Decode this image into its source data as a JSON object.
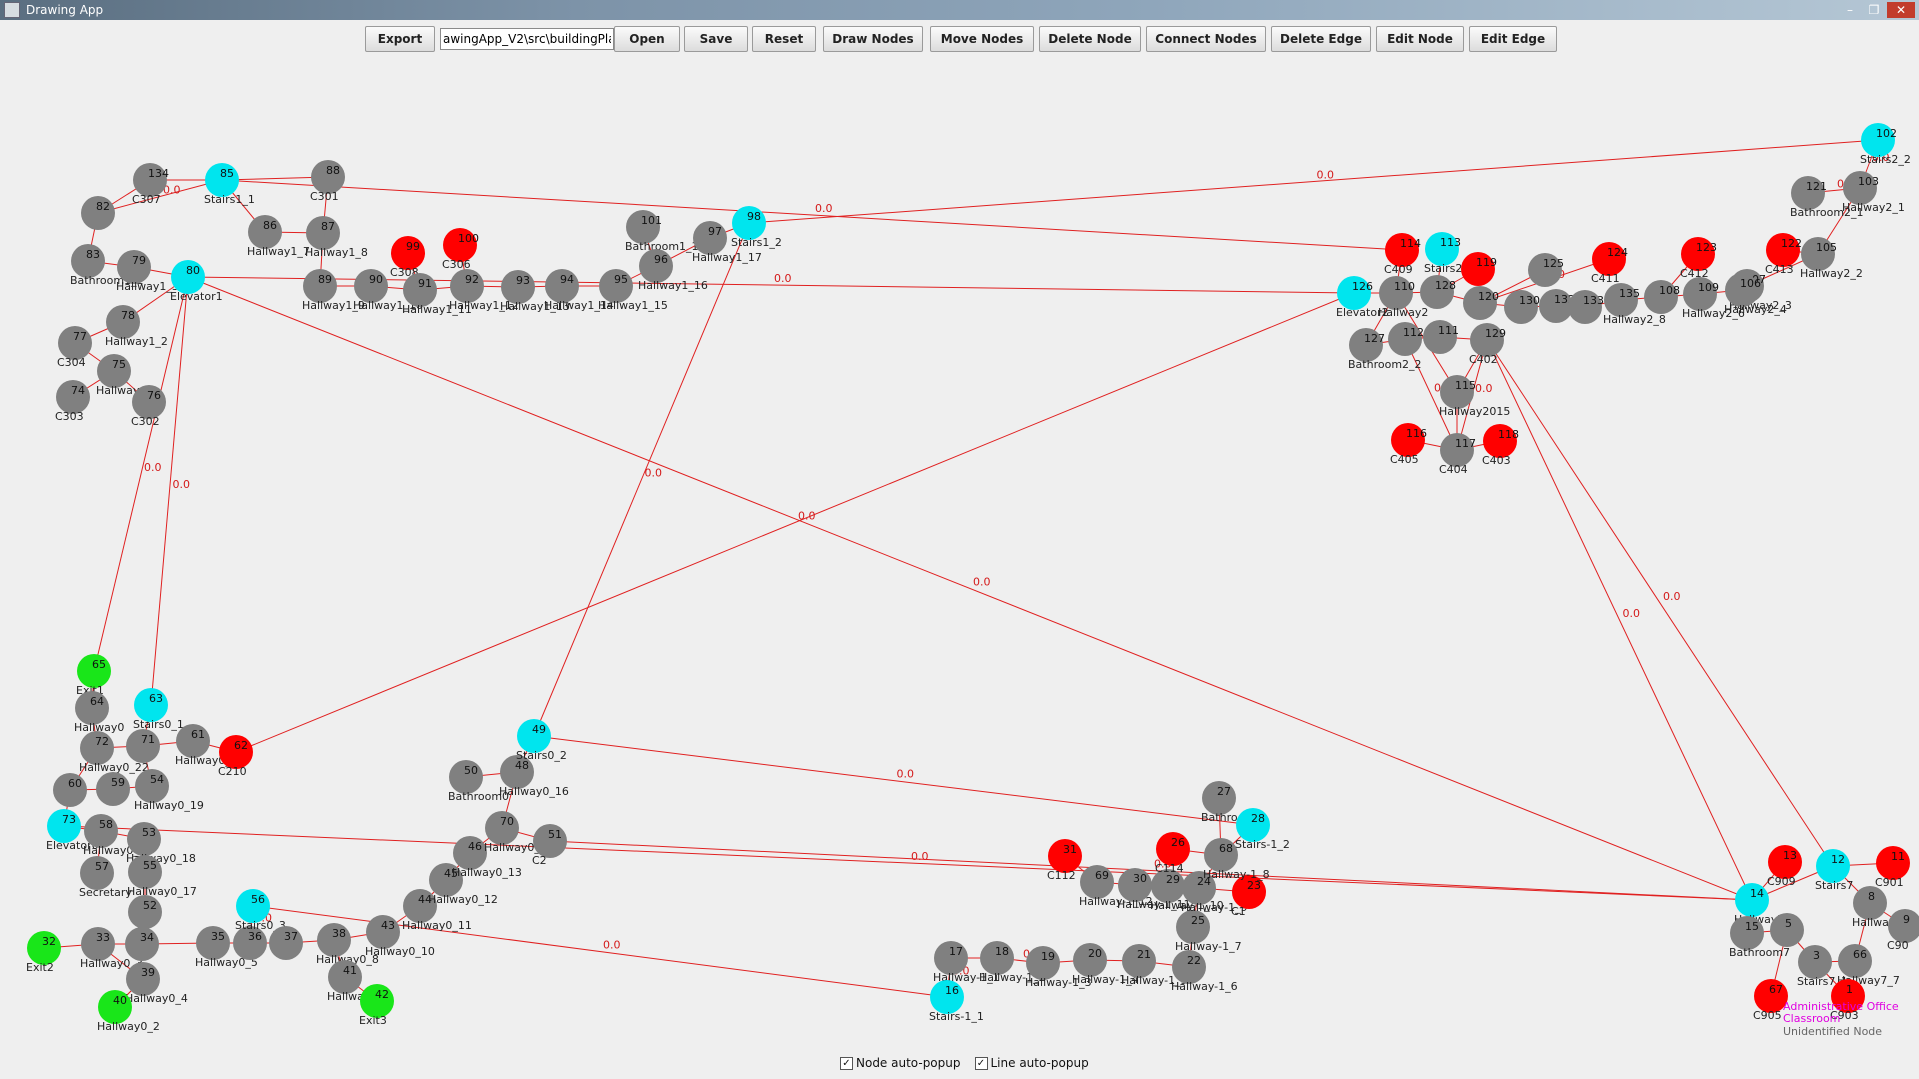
{
  "window": {
    "title": "Drawing App"
  },
  "toolbar": {
    "export_label": "Export",
    "path_value": "awingApp_V2\\src\\buildingPlan",
    "open_label": "Open",
    "save_label": "Save",
    "reset_label": "Reset",
    "draw_nodes_label": "Draw Nodes",
    "move_nodes_label": "Move Nodes",
    "delete_node_label": "Delete Node",
    "connect_nodes_label": "Connect Nodes",
    "delete_edge_label": "Delete Edge",
    "edit_node_label": "Edit Node",
    "edit_edge_label": "Edit Edge"
  },
  "options": {
    "node_popup_label": "Node auto-popup",
    "node_popup_checked": true,
    "line_popup_label": "Line auto-popup",
    "line_popup_checked": true
  },
  "colors": {
    "hallway": "#808080",
    "stairs": "#00e5ee",
    "room": "#ff0000",
    "exit": "#19e619",
    "edge": "#e02020"
  },
  "graph": {
    "nodes": [
      {
        "id": "134",
        "label": "C307",
        "type": "hallway"
      },
      {
        "id": "85",
        "label": "Stairs1_1",
        "type": "stairs"
      },
      {
        "id": "88",
        "label": "C301",
        "type": "hallway"
      },
      {
        "id": "82",
        "label": "",
        "type": "hallway"
      },
      {
        "id": "86",
        "label": "Hallway1_7",
        "type": "hallway"
      },
      {
        "id": "87",
        "label": "Hallway1_8",
        "type": "hallway"
      },
      {
        "id": "83",
        "label": "Bathroom1_2",
        "type": "hallway"
      },
      {
        "id": "79",
        "label": "Hallway1_3",
        "type": "hallway"
      },
      {
        "id": "80",
        "label": "Elevator1",
        "type": "stairs"
      },
      {
        "id": "78",
        "label": "Hallway1_2",
        "type": "hallway"
      },
      {
        "id": "77",
        "label": "C304",
        "type": "hallway"
      },
      {
        "id": "75",
        "label": "Hallway",
        "type": "hallway"
      },
      {
        "id": "74",
        "label": "C303",
        "type": "hallway"
      },
      {
        "id": "76",
        "label": "C302",
        "type": "hallway"
      },
      {
        "id": "99",
        "label": "C308",
        "type": "room"
      },
      {
        "id": "100",
        "label": "C306",
        "type": "room"
      },
      {
        "id": "89",
        "label": "Hallway1_9",
        "type": "hallway"
      },
      {
        "id": "90",
        "label": "Hallway1_10",
        "type": "hallway"
      },
      {
        "id": "91",
        "label": "Hallway1_11",
        "type": "hallway"
      },
      {
        "id": "92",
        "label": "Hallway1_12",
        "type": "hallway"
      },
      {
        "id": "93",
        "label": "Hallway1_13",
        "type": "hallway"
      },
      {
        "id": "94",
        "label": "Hallway1_14",
        "type": "hallway"
      },
      {
        "id": "95",
        "label": "Hallway1_15",
        "type": "hallway"
      },
      {
        "id": "101",
        "label": "Bathroom1_1",
        "type": "hallway"
      },
      {
        "id": "97",
        "label": "Hallway1_17",
        "type": "hallway"
      },
      {
        "id": "98",
        "label": "Stairs1_2",
        "type": "stairs"
      },
      {
        "id": "96",
        "label": "Hallway1_16",
        "type": "hallway"
      },
      {
        "id": "102",
        "label": "Stairs2_2",
        "type": "stairs"
      },
      {
        "id": "121",
        "label": "Bathroom2_1",
        "type": "hallway"
      },
      {
        "id": "103",
        "label": "Hallway2_1",
        "type": "hallway"
      },
      {
        "id": "122",
        "label": "C413",
        "type": "room"
      },
      {
        "id": "105",
        "label": "Hallway2_2",
        "type": "hallway"
      },
      {
        "id": "107",
        "label": "Hallway2_3",
        "type": "hallway"
      },
      {
        "id": "123",
        "label": "C412",
        "type": "room"
      },
      {
        "id": "124",
        "label": "C411",
        "type": "room"
      },
      {
        "id": "125",
        "label": "",
        "type": "hallway"
      },
      {
        "id": "114",
        "label": "C409",
        "type": "room"
      },
      {
        "id": "113",
        "label": "Stairs2_1",
        "type": "stairs"
      },
      {
        "id": "119",
        "label": "",
        "type": "room"
      },
      {
        "id": "126",
        "label": "Elevator2",
        "type": "stairs"
      },
      {
        "id": "110",
        "label": "Hallway2",
        "type": "hallway"
      },
      {
        "id": "128",
        "label": "",
        "type": "hallway"
      },
      {
        "id": "120",
        "label": "",
        "type": "hallway"
      },
      {
        "id": "130",
        "label": "",
        "type": "hallway"
      },
      {
        "id": "132",
        "label": "",
        "type": "hallway"
      },
      {
        "id": "133",
        "label": "",
        "type": "hallway"
      },
      {
        "id": "135",
        "label": "Hallway2_8",
        "type": "hallway"
      },
      {
        "id": "108",
        "label": "",
        "type": "hallway"
      },
      {
        "id": "109",
        "label": "Hallway2_6",
        "type": "hallway"
      },
      {
        "id": "106",
        "label": "Hallway2_4",
        "type": "hallway"
      },
      {
        "id": "127",
        "label": "Bathroom2_2",
        "type": "hallway"
      },
      {
        "id": "112",
        "label": "",
        "type": "hallway"
      },
      {
        "id": "111",
        "label": "",
        "type": "hallway"
      },
      {
        "id": "129",
        "label": "C402",
        "type": "hallway"
      },
      {
        "id": "115",
        "label": "Hallway2015",
        "type": "hallway"
      },
      {
        "id": "116",
        "label": "C405",
        "type": "room"
      },
      {
        "id": "117",
        "label": "C404",
        "type": "hallway"
      },
      {
        "id": "118",
        "label": "C403",
        "type": "room"
      },
      {
        "id": "65",
        "label": "Exit1",
        "type": "exit"
      },
      {
        "id": "64",
        "label": "Hallway0",
        "type": "hallway"
      },
      {
        "id": "63",
        "label": "Stairs0_1",
        "type": "stairs"
      },
      {
        "id": "72",
        "label": "Hallway0_22",
        "type": "hallway"
      },
      {
        "id": "71",
        "label": "",
        "type": "hallway"
      },
      {
        "id": "61",
        "label": "Hallway0_20",
        "type": "hallway"
      },
      {
        "id": "62",
        "label": "C210",
        "type": "room"
      },
      {
        "id": "60",
        "label": "",
        "type": "hallway"
      },
      {
        "id": "59",
        "label": "",
        "type": "hallway"
      },
      {
        "id": "54",
        "label": "Hallway0_19",
        "type": "hallway"
      },
      {
        "id": "73",
        "label": "Elevator0",
        "type": "stairs"
      },
      {
        "id": "58",
        "label": "Hallway0_21",
        "type": "hallway"
      },
      {
        "id": "53",
        "label": "Hallway0_18",
        "type": "hallway"
      },
      {
        "id": "57",
        "label": "Secretary",
        "type": "hallway"
      },
      {
        "id": "55",
        "label": "Hallway0_17",
        "type": "hallway"
      },
      {
        "id": "52",
        "label": "",
        "type": "hallway"
      },
      {
        "id": "32",
        "label": "Exit2",
        "type": "exit"
      },
      {
        "id": "33",
        "label": "Hallway0_3",
        "type": "hallway"
      },
      {
        "id": "39",
        "label": "Hallway0_4",
        "type": "hallway"
      },
      {
        "id": "40",
        "label": "Hallway0_2",
        "type": "exit"
      },
      {
        "id": "34",
        "label": "",
        "type": "hallway"
      },
      {
        "id": "35",
        "label": "Hallway0_5",
        "type": "hallway"
      },
      {
        "id": "36",
        "label": "",
        "type": "hallway"
      },
      {
        "id": "56",
        "label": "Stairs0_3",
        "type": "stairs"
      },
      {
        "id": "37",
        "label": "",
        "type": "hallway"
      },
      {
        "id": "38",
        "label": "Hallway0_8",
        "type": "hallway"
      },
      {
        "id": "41",
        "label": "Hallway0_9",
        "type": "hallway"
      },
      {
        "id": "42",
        "label": "Exit3",
        "type": "exit"
      },
      {
        "id": "43",
        "label": "Hallway0_10",
        "type": "hallway"
      },
      {
        "id": "44",
        "label": "Hallway0_11",
        "type": "hallway"
      },
      {
        "id": "45",
        "label": "Hallway0_12",
        "type": "hallway"
      },
      {
        "id": "46",
        "label": "Hallway0_13",
        "type": "hallway"
      },
      {
        "id": "70",
        "label": "Hallway0_14",
        "type": "hallway"
      },
      {
        "id": "51",
        "label": "C2",
        "type": "hallway"
      },
      {
        "id": "50",
        "label": "Bathroom0",
        "type": "hallway"
      },
      {
        "id": "48",
        "label": "Hallway0_16",
        "type": "hallway"
      },
      {
        "id": "49",
        "label": "Stairs0_2",
        "type": "stairs"
      },
      {
        "id": "17",
        "label": "Hallway-1_1",
        "type": "hallway"
      },
      {
        "id": "16",
        "label": "Stairs-1_1",
        "type": "stairs"
      },
      {
        "id": "18",
        "label": "Hallway-1_2",
        "type": "hallway"
      },
      {
        "id": "19",
        "label": "Hallway-1_3",
        "type": "hallway"
      },
      {
        "id": "20",
        "label": "Hallway-1_4",
        "type": "hallway"
      },
      {
        "id": "21",
        "label": "Hallway-1_5",
        "type": "hallway"
      },
      {
        "id": "22",
        "label": "Hallway-1_6",
        "type": "hallway"
      },
      {
        "id": "25",
        "label": "Hallway-1_7",
        "type": "hallway"
      },
      {
        "id": "31",
        "label": "C112",
        "type": "room"
      },
      {
        "id": "69",
        "label": "Hallway-1_12",
        "type": "hallway"
      },
      {
        "id": "30",
        "label": "Hallway-1_11",
        "type": "hallway"
      },
      {
        "id": "29",
        "label": "Hallway-1_10",
        "type": "hallway"
      },
      {
        "id": "26",
        "label": "C114",
        "type": "room"
      },
      {
        "id": "24",
        "label": "Hallway-1_9",
        "type": "hallway"
      },
      {
        "id": "23",
        "label": "C1",
        "type": "room"
      },
      {
        "id": "68",
        "label": "Hallway-1_8",
        "type": "hallway"
      },
      {
        "id": "27",
        "label": "Bathro",
        "type": "hallway"
      },
      {
        "id": "28",
        "label": "Stairs-1_2",
        "type": "stairs"
      },
      {
        "id": "13",
        "label": "C909",
        "type": "room"
      },
      {
        "id": "12",
        "label": "Stairs7",
        "type": "stairs"
      },
      {
        "id": "11",
        "label": "C901",
        "type": "room"
      },
      {
        "id": "14",
        "label": "Hallway7",
        "type": "stairs"
      },
      {
        "id": "8",
        "label": "Hallway7_6",
        "type": "hallway"
      },
      {
        "id": "15",
        "label": "Bathroom7",
        "type": "hallway"
      },
      {
        "id": "5",
        "label": "",
        "type": "hallway"
      },
      {
        "id": "3",
        "label": "Stairs7_1",
        "type": "hallway"
      },
      {
        "id": "66",
        "label": "Hallway7_7",
        "type": "hallway"
      },
      {
        "id": "9",
        "label": "C90",
        "type": "hallway"
      },
      {
        "id": "67",
        "label": "C905",
        "type": "room"
      },
      {
        "id": "1",
        "label": "C903",
        "type": "room"
      }
    ],
    "extra_labels": [
      "Administrative Office",
      "Classroom",
      "Unidentified Node"
    ],
    "edge_weight": "0.0"
  }
}
